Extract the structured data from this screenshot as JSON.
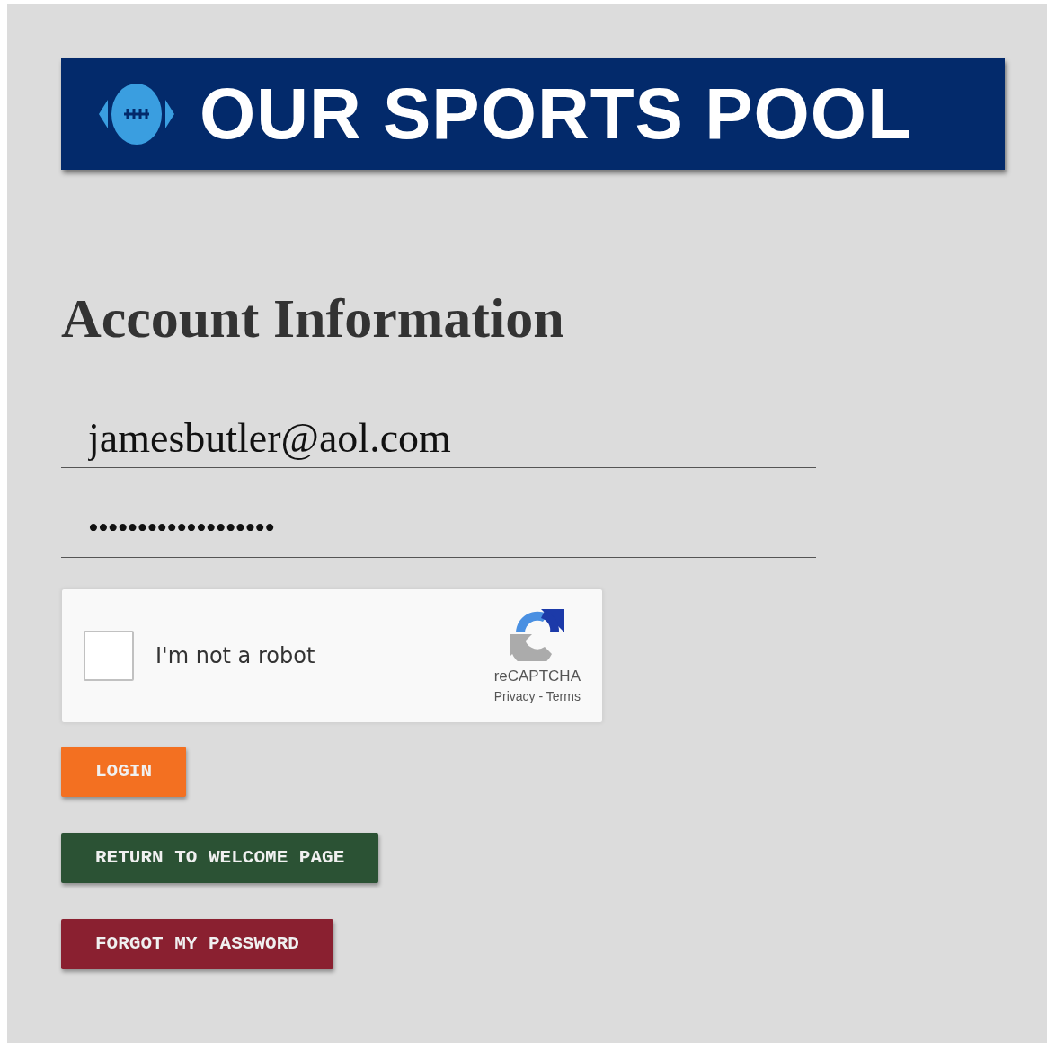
{
  "banner": {
    "title": "OUR SPORTS POOL"
  },
  "heading": "Account Information",
  "email": {
    "value": "jamesbutler@aol.com"
  },
  "password": {
    "value": "•••••••••••••••••••"
  },
  "captcha": {
    "label": "I'm not a robot",
    "checked": false,
    "brand": "reCAPTCHA",
    "privacy": "Privacy",
    "separator": "-",
    "terms": "Terms"
  },
  "buttons": [
    {
      "label": "LOGIN",
      "kind": "login"
    },
    {
      "label": "RETURN TO WELCOME PAGE",
      "kind": "return"
    },
    {
      "label": "FORGOT MY PASSWORD",
      "kind": "forgot"
    }
  ]
}
